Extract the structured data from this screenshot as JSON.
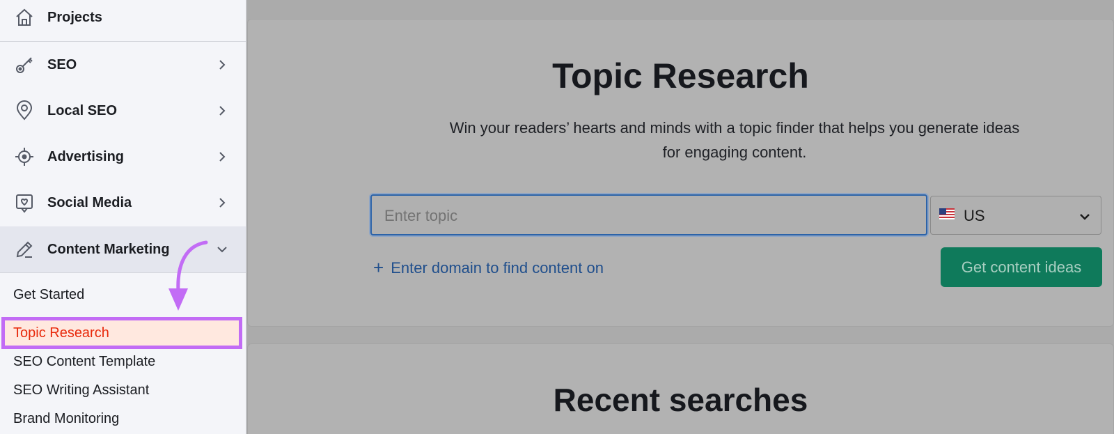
{
  "sidebar": {
    "items": [
      {
        "label": "Projects",
        "icon": "home-icon"
      },
      {
        "label": "SEO",
        "icon": "key-icon"
      },
      {
        "label": "Local SEO",
        "icon": "location-pin-icon"
      },
      {
        "label": "Advertising",
        "icon": "target-icon"
      },
      {
        "label": "Social Media",
        "icon": "social-chat-icon"
      },
      {
        "label": "Content Marketing",
        "icon": "pencil-icon"
      }
    ],
    "content_marketing_subitems": [
      "Get Started",
      "Topic Research",
      "SEO Content Template",
      "SEO Writing Assistant",
      "Brand Monitoring"
    ]
  },
  "main": {
    "title": "Topic Research",
    "subtitle_line1": "Win your readers’ hearts and minds with a topic finder that helps you generate ideas",
    "subtitle_line2": "for engaging content.",
    "topic_input": {
      "value": "",
      "placeholder": "Enter topic"
    },
    "country_select": {
      "value": "US",
      "flag": "us-flag-icon"
    },
    "domain_link": "Enter domain to find content on",
    "cta_button": "Get content ideas",
    "recent_title": "Recent searches"
  },
  "colors": {
    "highlight_border": "#c26cf5",
    "highlight_bg": "#ffe8df",
    "active_text": "#e8290b",
    "cta_bg": "#0f7a5b",
    "link": "#1f4e8c"
  }
}
